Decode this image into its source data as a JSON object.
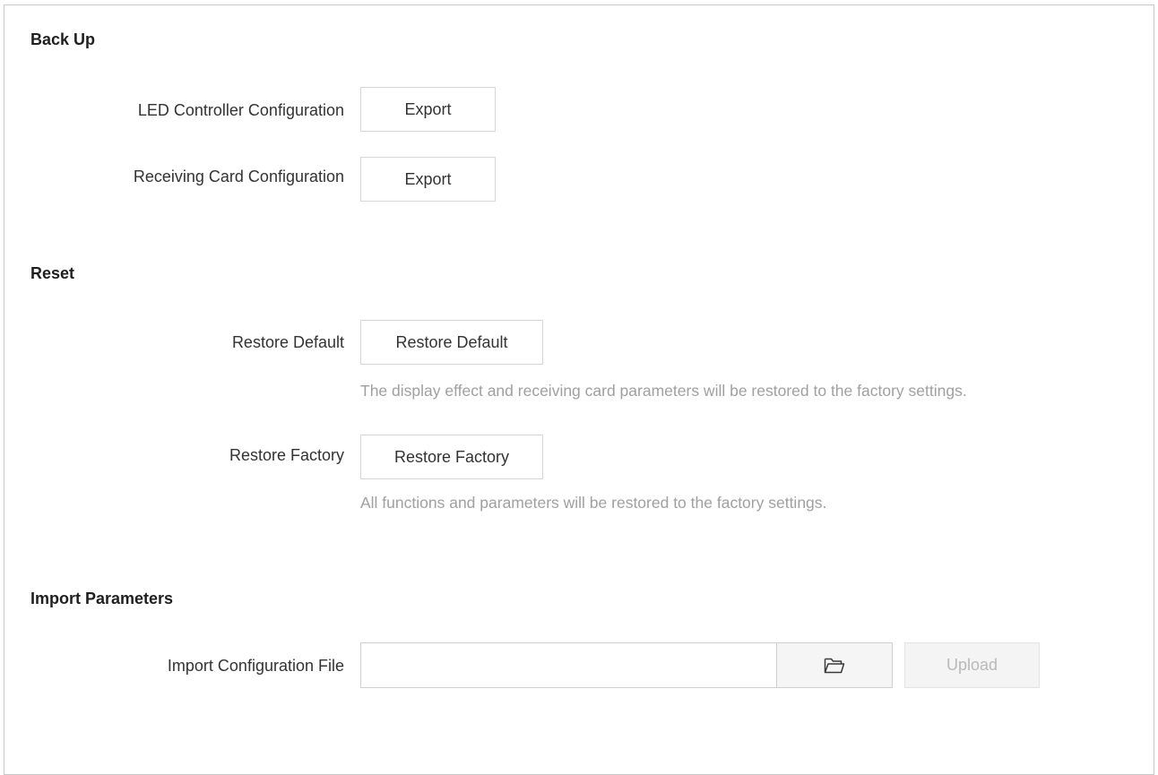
{
  "backup": {
    "title": "Back Up",
    "rows": [
      {
        "label": "LED Controller Configuration",
        "button": "Export"
      },
      {
        "label": "Receiving Card Configuration",
        "button": "Export"
      }
    ]
  },
  "reset": {
    "title": "Reset",
    "rows": [
      {
        "label": "Restore Default",
        "button": "Restore Default",
        "hint": "The display effect and receiving card parameters will be restored to the factory settings."
      },
      {
        "label": "Restore Factory",
        "button": "Restore Factory",
        "hint": "All functions and parameters will be restored to the factory settings."
      }
    ]
  },
  "import_params": {
    "title": "Import Parameters",
    "label": "Import Configuration File",
    "file_value": "",
    "browse_icon": "folder-open-icon",
    "upload_button": "Upload",
    "upload_disabled": true
  }
}
